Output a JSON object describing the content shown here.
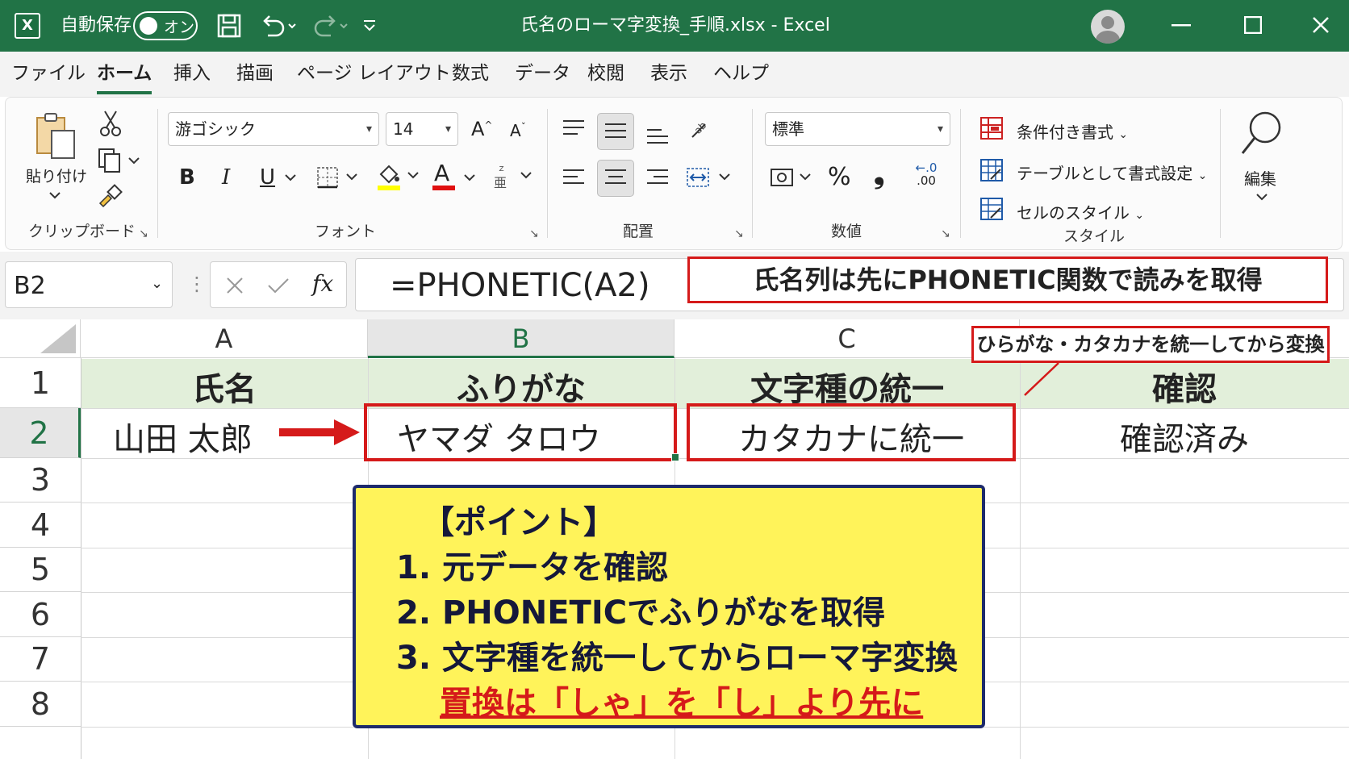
{
  "titlebar": {
    "app_icon": "excel-icon",
    "autosave_label": "自動保存",
    "autosave_state": "オン",
    "title": "氏名のローマ字変換_手順.xlsx  -  Excel"
  },
  "menu": {
    "items": [
      "ファイル",
      "ホーム",
      "挿入",
      "描画",
      "ページ レイアウト",
      "数式",
      "データ",
      "校閲",
      "表示",
      "ヘルプ"
    ],
    "active": "ホーム"
  },
  "ribbon": {
    "clipboard": {
      "paste_label": "貼り付け",
      "group_label": "クリップボード"
    },
    "font": {
      "font_name": "游ゴシック",
      "font_size": "14",
      "bold": "B",
      "italic": "I",
      "underline": "U",
      "group_label": "フォント",
      "grow": "A",
      "shrink": "A",
      "color_a": "A"
    },
    "alignment": {
      "group_label": "配置"
    },
    "number": {
      "format": "標準",
      "percent": "%",
      "comma": "❟",
      "dec_top": "←.0",
      "dec_bottom": ".00",
      "group_label": "数値"
    },
    "styles": {
      "conditional": "条件付き書式",
      "table": "テーブルとして書式設定",
      "cell_styles": "セルのスタイル",
      "group_label": "スタイル"
    },
    "editing": {
      "label": "編集"
    }
  },
  "formula_bar": {
    "name_box": "B2",
    "fx": "fx",
    "formula": "=PHONETIC(A2)",
    "callout": "氏名列は先にPHONETIC関数で読みを取得"
  },
  "sheet": {
    "columns": [
      "A",
      "B",
      "C"
    ],
    "rows": [
      "1",
      "2",
      "3",
      "4",
      "5",
      "6",
      "7",
      "8"
    ],
    "header_row": [
      "氏名",
      "ふりがな",
      "文字種の統一",
      "確認"
    ],
    "data_row": [
      "山田 太郎",
      "ヤマダ タロウ",
      "カタカナに統一",
      "確認済み"
    ],
    "side_callout": "ひらがな・カタカナを統一してから変換"
  },
  "point_box": {
    "title": "【ポイント】",
    "steps": [
      "1. 元データを確認",
      "2. PHONETICでふりがなを取得",
      "3. 文字種を統一してからローマ字変換"
    ],
    "note": "置換は「しゃ」を「し」より先に"
  },
  "colors": {
    "excel_green": "#217346",
    "highlight_red": "#d51a1a",
    "note_yellow": "#fff35a",
    "header_fill": "#e2efda"
  }
}
